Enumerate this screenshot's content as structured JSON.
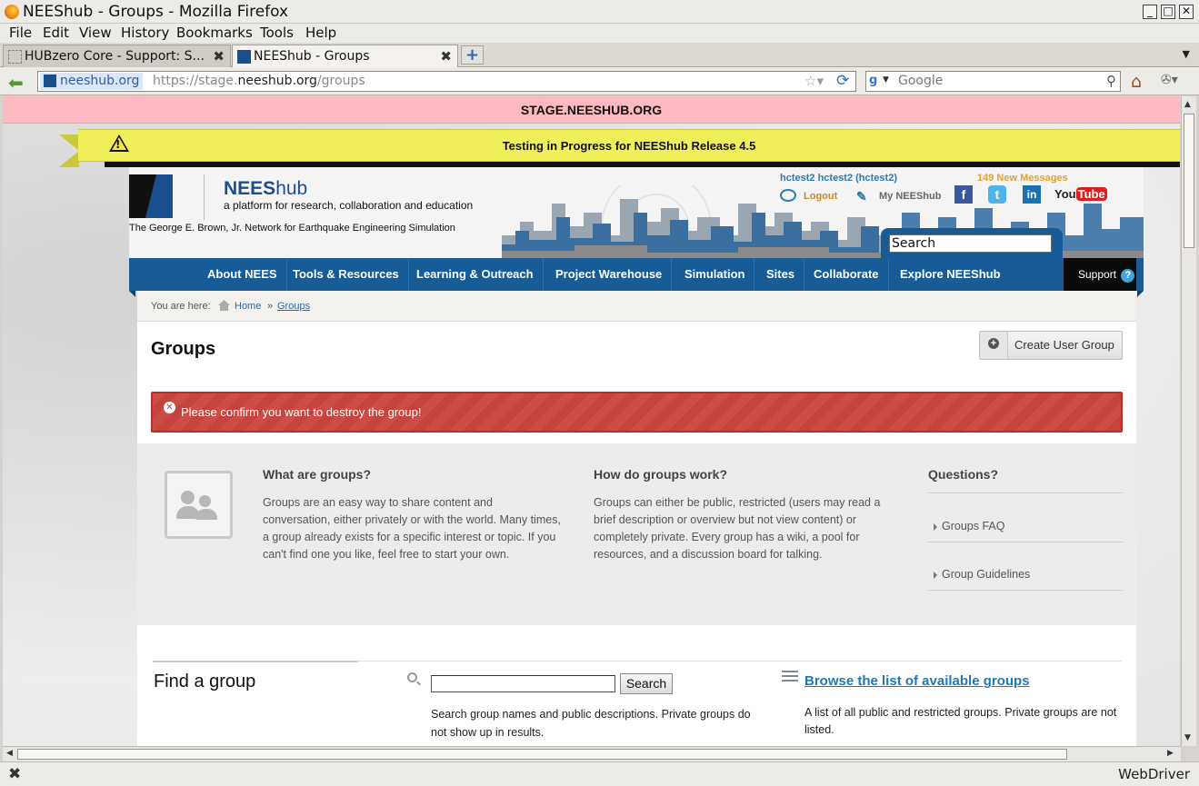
{
  "window": {
    "title": "NEEShub - Groups - Mozilla Firefox",
    "controls": [
      "_",
      "□",
      "✕"
    ]
  },
  "menu": [
    "File",
    "Edit",
    "View",
    "History",
    "Bookmarks",
    "Tools",
    "Help"
  ],
  "tabs": [
    {
      "label": "HUBzero Core - Support: S...",
      "active": false
    },
    {
      "label": "NEEShub - Groups",
      "active": true
    }
  ],
  "navbar": {
    "site_identity": "neeshub.org",
    "url_prefix": "https://stage.",
    "url_domain": "neeshub.org",
    "url_path": "/groups",
    "search_placeholder": "Google",
    "search_engine": "g"
  },
  "status": {
    "text": "WebDriver"
  },
  "page": {
    "stage_banner": "STAGE.NEESHUB.ORG",
    "test_banner": "Testing in Progress for NEEShub Release 4.5",
    "header": {
      "brand_bold": "NEES",
      "brand_light": "hub",
      "tagline": "a platform for research, collaboration and education",
      "network": "The George E. Brown, Jr. Network for Earthquake Engineering Simulation",
      "user": "hctest2 hctest2 (hctest2)",
      "messages": "149 New Messages",
      "logout": "Logout",
      "my_hub": "My NEEShub",
      "facebook": "f",
      "twitter": "t",
      "linkedin": "in",
      "youtube_you": "You",
      "youtube_tube": "Tube",
      "search_value": "Search"
    },
    "nav": {
      "items": [
        "About NEES",
        "Tools & Resources",
        "Learning & Outreach",
        "Project Warehouse",
        "Simulation",
        "Sites",
        "Collaborate",
        "Explore NEEShub"
      ],
      "support": "Support",
      "support_icon": "?"
    },
    "breadcrumbs": {
      "label": "You are here:",
      "home": "Home",
      "separator": "»",
      "current": "Groups"
    },
    "title": "Groups",
    "create_button": "Create User Group",
    "error_message": "Please confirm you want to destroy the group!",
    "about": {
      "what_title": "What are groups?",
      "what_text": "Groups are an easy way to share content and conversation, either privately or with the world. Many times, a group already exists for a specific interest or topic. If you can't find one you like, feel free to start your own.",
      "how_title": "How do groups work?",
      "how_text": "Groups can either be public, restricted (users may read a brief description or overview but not view content) or completely private. Every group has a wiki, a pool for resources, and a discussion board for talking.",
      "questions_title": "Questions?",
      "faq_link": "Groups FAQ",
      "guidelines_link": "Group Guidelines"
    },
    "find": {
      "title": "Find a group",
      "search_button": "Search",
      "search_value": "",
      "search_desc": "Search group names and public descriptions. Private groups do not show up in results.",
      "browse_link": "Browse the list of available groups",
      "browse_desc": "A list of all public and restricted groups. Private groups are not listed."
    }
  }
}
